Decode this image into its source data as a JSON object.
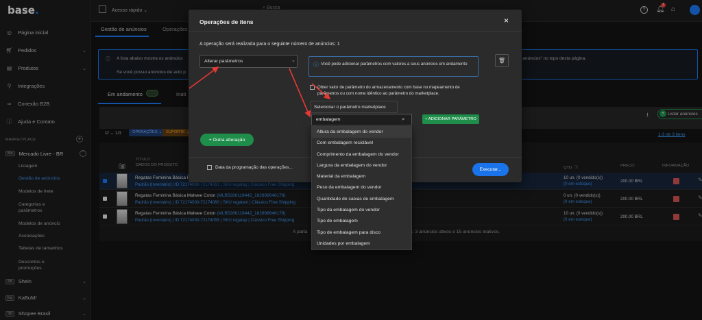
{
  "brand": {
    "name": "base",
    "dot": "."
  },
  "topbar": {
    "quick_access": "Acesso rápido",
    "search_placeholder": "Busca",
    "notif_count": "1"
  },
  "sidebar": {
    "items": [
      {
        "label": "Página inicial"
      },
      {
        "label": "Pedidos"
      },
      {
        "label": "Produtos"
      },
      {
        "label": "Integrações"
      },
      {
        "label": "Conexão B2B"
      },
      {
        "label": "Ajuda e Contato"
      }
    ],
    "section": "MARKETPLACE",
    "mercado": {
      "badge": "Me",
      "label": "Mercado Livre - BR"
    },
    "subs": [
      "Listagem",
      "Gestão de anúncios",
      "Modelos de frete",
      "Categorias e",
      "parâmetros",
      "Modelos de anúncio",
      "Associações",
      "Tabelas de tamanhos",
      "Descontos e",
      "promoções"
    ],
    "mkts": [
      {
        "badge": "Sh",
        "label": "Shein"
      },
      {
        "badge": "Ka",
        "label": "KaBuM!"
      },
      {
        "badge": "Sh",
        "label": "Shopee Brasil"
      }
    ]
  },
  "tabs": {
    "t1": "Gestão de anúncios",
    "t2": "Operações"
  },
  "info": {
    "line1": "A lista abaixo mostra os anúncios",
    "line1_right": "vertar anúncios\" no topo desta página.",
    "line2": "Se você possui anúncios de auto p"
  },
  "status_tabs": {
    "active": "Em andamento",
    "inactive": "Inati",
    "count": ""
  },
  "toolbar": {
    "count": "1/3",
    "operacoes": "OPERAÇÕES",
    "suporte": "SUPORTE",
    "list_btn": "Listar anúncios",
    "pager": "1-3 de 3 itens",
    "pager_a": "1-3"
  },
  "table": {
    "col_title1": "TÍTULO",
    "col_title2": "DADOS DO PRODUTO",
    "col_qty": "QTD.",
    "col_price": "PREÇO",
    "col_info": "INFORMAÇÃO",
    "rows": [
      {
        "title": "Regatas Feminina Básica F",
        "meta": "Padrão (Inventário) | ID 72174030-72174061 | SKU regatag | Clássico Free Shipping",
        "mlb": "",
        "qty": "10 un. (0 vendido(s))",
        "stock": "(0 em estoque)",
        "price": "200.00 BRL"
      },
      {
        "title": "Regatas Feminina Básica Malwee Coton",
        "mlb": "(MLB5286118442_182896646178)",
        "meta": "Padrão (Inventário) | ID 72174030-72174060 | SKU regatam | Clássico Free Shipping",
        "qty": "0 un. (0 vendido(s))",
        "stock": "(0 em estoque)",
        "price": "200.00 BRL"
      },
      {
        "title": "Regatas Feminina Básica Malwee Coton",
        "mlb": "(MLB5286118442_182896646178)",
        "meta": "Padrão (Inventário) | ID 72174030-72174059 | SKU regatap | Clássico Free Shipping",
        "qty": "10 un. (0 vendido(s))",
        "stock": "(0 em estoque)",
        "price": "200.00 BRL"
      }
    ],
    "footer_left": "A parta",
    "footer_right": "ará: 3 anúncios ativos e 15 anúncios inativos."
  },
  "modal": {
    "title": "Operações de itens",
    "close": "×",
    "subtitle": "A operação será realizada para o seguinte número de anúncios: 1",
    "select_value": "Alterar parâmetros",
    "info_text": "Você pode adicionar parâmetros com valores a seus anúncios em andamento",
    "checkbox_text": "Obter valor de parâmetro do armazenamento com base no mapeamento de parâmetros ou com nome idêntico ao parâmetro do marketplace.",
    "param_select_label": "Selecionar o parâmetro marketplace",
    "search_value": "embalagem",
    "add_param": "ADICIONAR PARÂMETRO",
    "other_change": "Outra alteração",
    "schedule": "Data da programação das operações...",
    "execute": "Executar..."
  },
  "dropdown": {
    "options": [
      "Altura da embalagem do vendor",
      "Com embalagem reciclável",
      "Comprimento da embalagem do vendor",
      "Largura da embalagem do vendor",
      "Material da embalagem",
      "Peso da embalagem do vendor",
      "Quantidade de caixas de embalagem",
      "Tipo da embalagem do vendor",
      "Tipo de embalagem",
      "Tipo de embalagem para disco",
      "Unidades por embalagem"
    ]
  },
  "colors": {
    "accent": "#1a73e8",
    "green": "#1e8e4a",
    "arrow": "#e53935"
  }
}
